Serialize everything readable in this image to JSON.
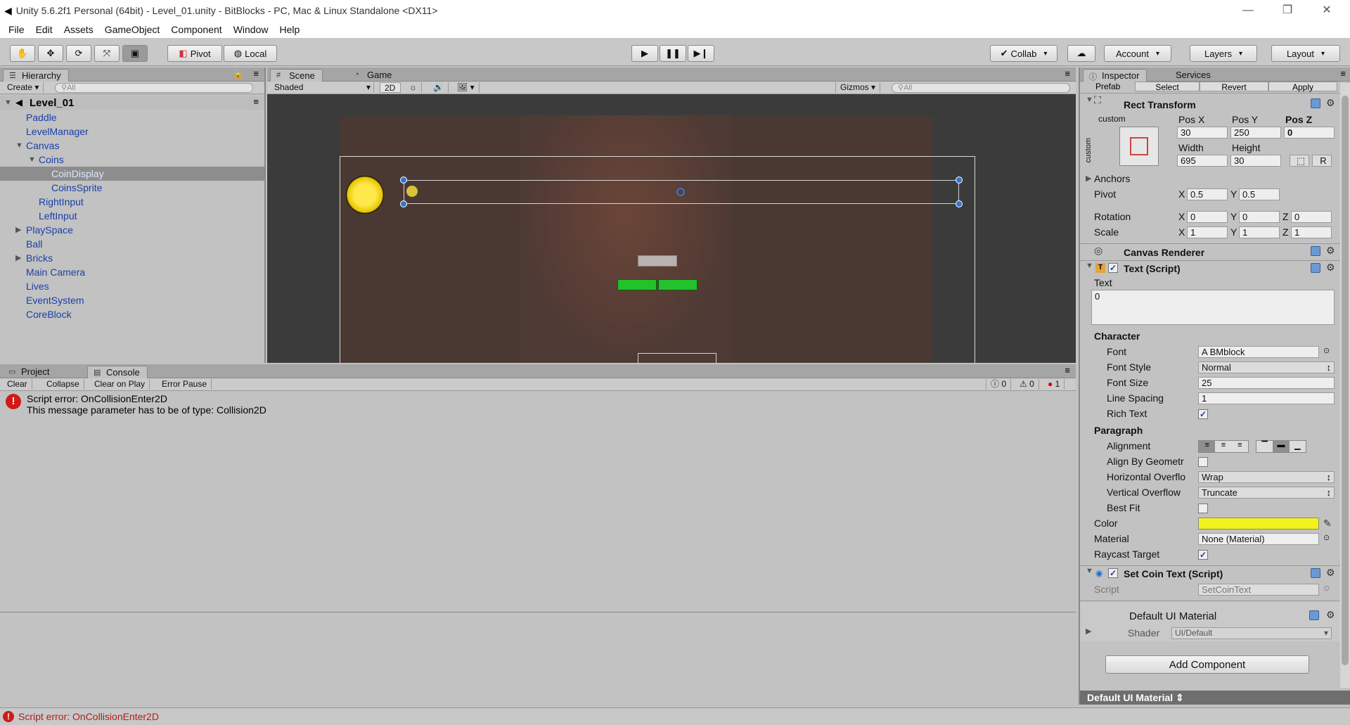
{
  "window": {
    "title": "Unity 5.6.2f1 Personal (64bit) - Level_01.unity - BitBlocks - PC, Mac & Linux Standalone <DX11>"
  },
  "menu": [
    "File",
    "Edit",
    "Assets",
    "GameObject",
    "Component",
    "Window",
    "Help"
  ],
  "toolbar": {
    "pivot": "Pivot",
    "local": "Local",
    "collab": "Collab",
    "account": "Account",
    "layers": "Layers",
    "layout": "Layout"
  },
  "hierarchy": {
    "tab": "Hierarchy",
    "create": "Create",
    "search_placeholder": "All",
    "scene": "Level_01",
    "items": [
      "Paddle",
      "LevelManager",
      "Canvas",
      "Coins",
      "CoinDisplay",
      "CoinsSprite",
      "RightInput",
      "LeftInput",
      "PlaySpace",
      "Ball",
      "Bricks",
      "Main Camera",
      "Lives",
      "EventSystem",
      "CoreBlock"
    ]
  },
  "scene": {
    "tab_scene": "Scene",
    "tab_game": "Game",
    "shading": "Shaded",
    "mode2d": "2D",
    "gizmos": "Gizmos",
    "search_placeholder": "All"
  },
  "console": {
    "tab_project": "Project",
    "tab_console": "Console",
    "clear": "Clear",
    "collapse": "Collapse",
    "clear_on_play": "Clear on Play",
    "error_pause": "Error Pause",
    "info_count": "0",
    "warn_count": "0",
    "error_count": "1",
    "message_line1": "Script error: OnCollisionEnter2D",
    "message_line2": "This message parameter has to be of type: Collision2D"
  },
  "inspector": {
    "tab": "Inspector",
    "tab_services": "Services",
    "prefab": "Prefab",
    "select": "Select",
    "revert": "Revert",
    "apply": "Apply",
    "rect": {
      "title": "Rect Transform",
      "custom": "custom",
      "posx_label": "Pos X",
      "posy_label": "Pos Y",
      "posz_label": "Pos Z",
      "posx": "30",
      "posy": "250",
      "posz": "0",
      "width_label": "Width",
      "height_label": "Height",
      "width": "695",
      "height": "30",
      "r": "R",
      "anchors": "Anchors",
      "pivot": "Pivot",
      "pivot_x": "0.5",
      "pivot_y": "0.5",
      "rotation": "Rotation",
      "rot_x": "0",
      "rot_y": "0",
      "rot_z": "0",
      "scale": "Scale",
      "scale_x": "1",
      "scale_y": "1",
      "scale_z": "1",
      "x": "X",
      "y": "Y",
      "z": "Z"
    },
    "canvas_renderer": "Canvas Renderer",
    "text": {
      "title": "Text (Script)",
      "text_label": "Text",
      "text_value": "0",
      "character": "Character",
      "font_label": "Font",
      "font": "BMblock",
      "font_style_label": "Font Style",
      "font_style": "Normal",
      "font_size_label": "Font Size",
      "font_size": "25",
      "line_spacing_label": "Line Spacing",
      "line_spacing": "1",
      "rich_text_label": "Rich Text",
      "paragraph": "Paragraph",
      "alignment_label": "Alignment",
      "align_geometry_label": "Align By Geometr",
      "h_overflow_label": "Horizontal Overflo",
      "h_overflow": "Wrap",
      "v_overflow_label": "Vertical Overflow",
      "v_overflow": "Truncate",
      "best_fit_label": "Best Fit",
      "color_label": "Color",
      "color": "#f2f21e",
      "material_label": "Material",
      "material": "None (Material)",
      "raycast_label": "Raycast Target"
    },
    "set_coin": {
      "title": "Set Coin Text (Script)",
      "script_label": "Script",
      "script": "SetCoinText"
    },
    "material": {
      "title": "Default UI Material",
      "shader_label": "Shader",
      "shader": "UI/Default"
    },
    "add_component": "Add Component",
    "footer": "Default UI Material"
  },
  "status": {
    "message": "Script error: OnCollisionEnter2D"
  }
}
